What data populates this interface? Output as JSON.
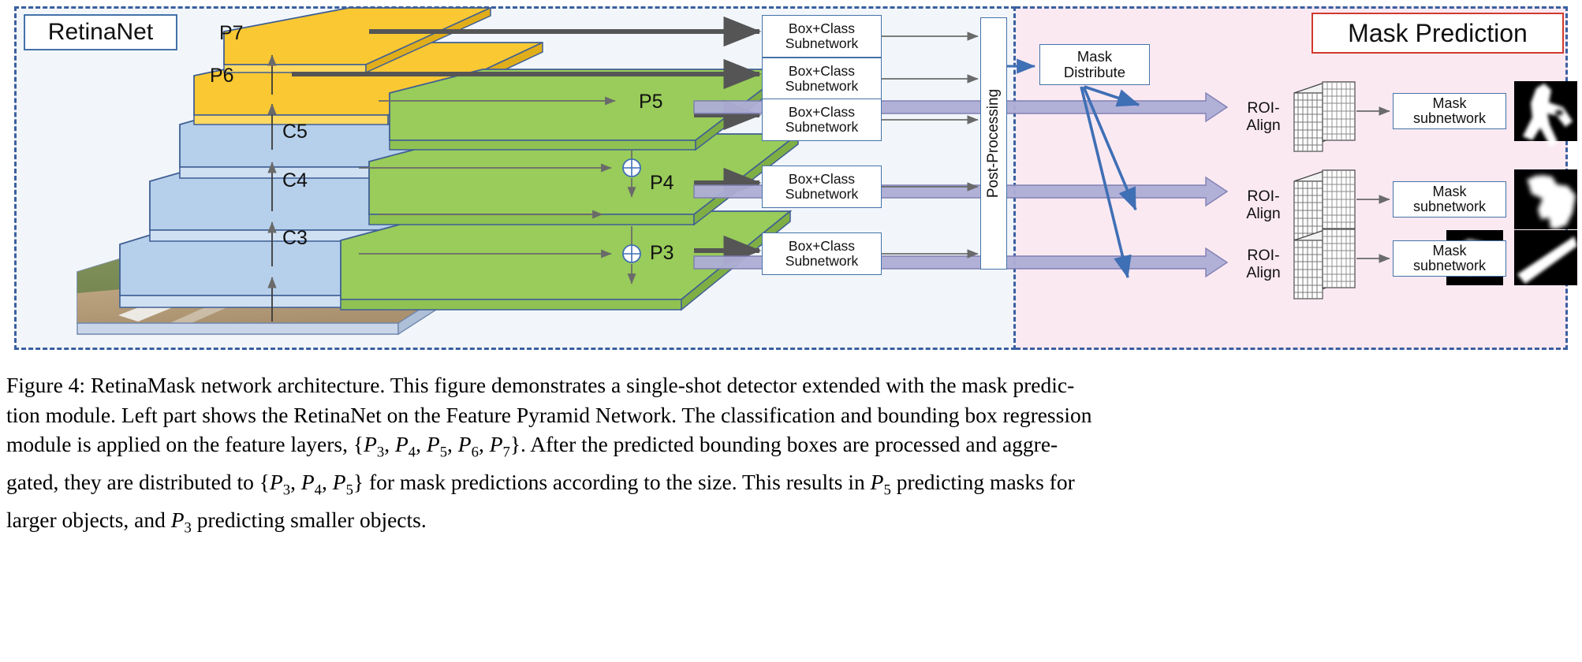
{
  "figure": {
    "left_panel": {
      "title": "RetinaNet"
    },
    "right_panel": {
      "title": "Mask Prediction"
    },
    "backbone_layers": [
      {
        "id": "C3",
        "label": "C3",
        "color": "#b6cfea"
      },
      {
        "id": "C4",
        "label": "C4",
        "color": "#b6cfea"
      },
      {
        "id": "C5",
        "label": "C5",
        "color": "#b6cfea"
      },
      {
        "id": "P6",
        "label": "P6",
        "color": "#fac832"
      },
      {
        "id": "P7",
        "label": "P7",
        "color": "#fac832"
      }
    ],
    "pyramid_layers": [
      {
        "id": "P3",
        "label": "P3",
        "color": "#99cc5a"
      },
      {
        "id": "P4",
        "label": "P4",
        "color": "#99cc5a"
      },
      {
        "id": "P5",
        "label": "P5",
        "color": "#99cc5a"
      }
    ],
    "subnetworks": [
      {
        "line1": "Box+Class",
        "line2": "Subnetwork"
      },
      {
        "line1": "Box+Class",
        "line2": "Subnetwork"
      },
      {
        "line1": "Box+Class",
        "line2": "Subnetwork"
      },
      {
        "line1": "Box+Class",
        "line2": "Subnetwork"
      },
      {
        "line1": "Box+Class",
        "line2": "Subnetwork"
      }
    ],
    "post_processing": {
      "label": "Post-Processing"
    },
    "mask_distribute": {
      "line1": "Mask",
      "line2": "Distribute"
    },
    "mask_branches": [
      {
        "roi_line1": "ROI-",
        "roi_line2": "Align",
        "sub_line1": "Mask",
        "sub_line2": "subnetwork"
      },
      {
        "roi_line1": "ROI-",
        "roi_line2": "Align",
        "sub_line1": "Mask",
        "sub_line2": "subnetwork"
      },
      {
        "roi_line1": "ROI-",
        "roi_line2": "Align",
        "sub_line1": "Mask",
        "sub_line2": "subnetwork"
      }
    ],
    "colors": {
      "left_panel_bg": "#f2f6fb",
      "right_panel_bg": "#fbe9f2",
      "panel_border": "#3a5fa0",
      "backbone_blue": "#b6cfea",
      "pyramid_green": "#99cc5a",
      "extra_yellow": "#fac832",
      "title_border_blue": "#4472a8",
      "title_border_red": "#d03a2c",
      "arrow_dark": "#555555",
      "arrow_blue": "#3f6fb5",
      "band_lavender": "#aeaed6"
    }
  },
  "caption": {
    "lines": [
      "Figure 4: RetinaMask network architecture. This figure demonstrates a single-shot detector extended with the mask predic-",
      "tion module. Left part shows the RetinaNet on the Feature Pyramid Network. The classification and bounding box regression",
      "module is applied on the feature layers, {P3, P4, P5, P6, P7}. After the predicted bounding boxes are processed and aggre-",
      "gated, they are distributed to {P3, P4, P5} for mask predictions according to the size. This results in P5 predicting masks for",
      "larger objects, and P3 predicting smaller objects."
    ]
  }
}
